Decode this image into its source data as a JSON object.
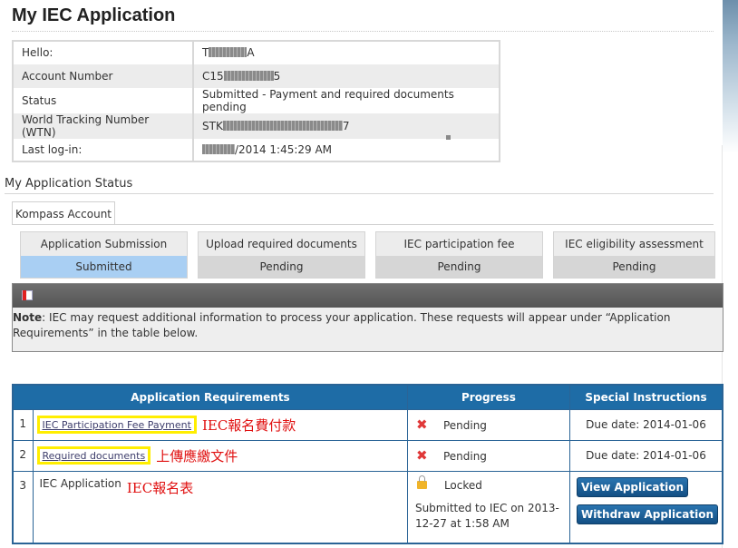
{
  "page": {
    "title": "My IEC Application"
  },
  "account_info": {
    "rows": [
      {
        "label": "Hello:",
        "prefix": "T",
        "suffix": "A"
      },
      {
        "label": "Account Number",
        "prefix": "C15",
        "suffix": "5"
      },
      {
        "label": "Status",
        "value": "Submitted - Payment and required documents pending"
      },
      {
        "label": "World Tracking Number (WTN)",
        "prefix": "STK",
        "suffix": "7"
      },
      {
        "label": "Last log-in:",
        "prefix": "",
        "suffix": "/2014 1:45:29 AM"
      }
    ]
  },
  "application_status": {
    "heading": "My Application Status",
    "tab_label": "Kompass Account",
    "steps": [
      {
        "title": "Application Submission",
        "state": "Submitted"
      },
      {
        "title": "Upload required documents",
        "state": "Pending"
      },
      {
        "title": "IEC participation fee",
        "state": "Pending"
      },
      {
        "title": "IEC eligibility assessment",
        "state": "Pending"
      }
    ]
  },
  "note": {
    "label": "Note",
    "text": ": IEC may request additional information to process your application. These requests will appear under “Application Requirements” in the table below."
  },
  "requirements": {
    "headers": [
      "Application Requirements",
      "Progress",
      "Special Instructions"
    ],
    "rows": [
      {
        "num": "1",
        "name": "IEC Participation Fee Payment",
        "annotation": "IEC報名費付款",
        "progress_icon": "x-icon",
        "progress": "Pending",
        "instructions": "Due date: 2014-01-06"
      },
      {
        "num": "2",
        "name": "Required documents",
        "annotation": "上傳應繳文件",
        "progress_icon": "x-icon",
        "progress": "Pending",
        "instructions": "Due date: 2014-01-06"
      },
      {
        "num": "3",
        "name": "IEC Application",
        "annotation": "IEC報名表",
        "progress_icon": "lock-icon",
        "progress": "Locked",
        "progress_detail": "Submitted to IEC on 2013-12-27 at 1:58 AM",
        "buttons": [
          "View Application",
          "Withdraw Application"
        ]
      }
    ]
  },
  "colors": {
    "header_blue": "#1e6ca6",
    "submitted_blue": "#a9cff3",
    "annotation_red": "#e01010",
    "highlight_yellow": "#ffee00"
  }
}
